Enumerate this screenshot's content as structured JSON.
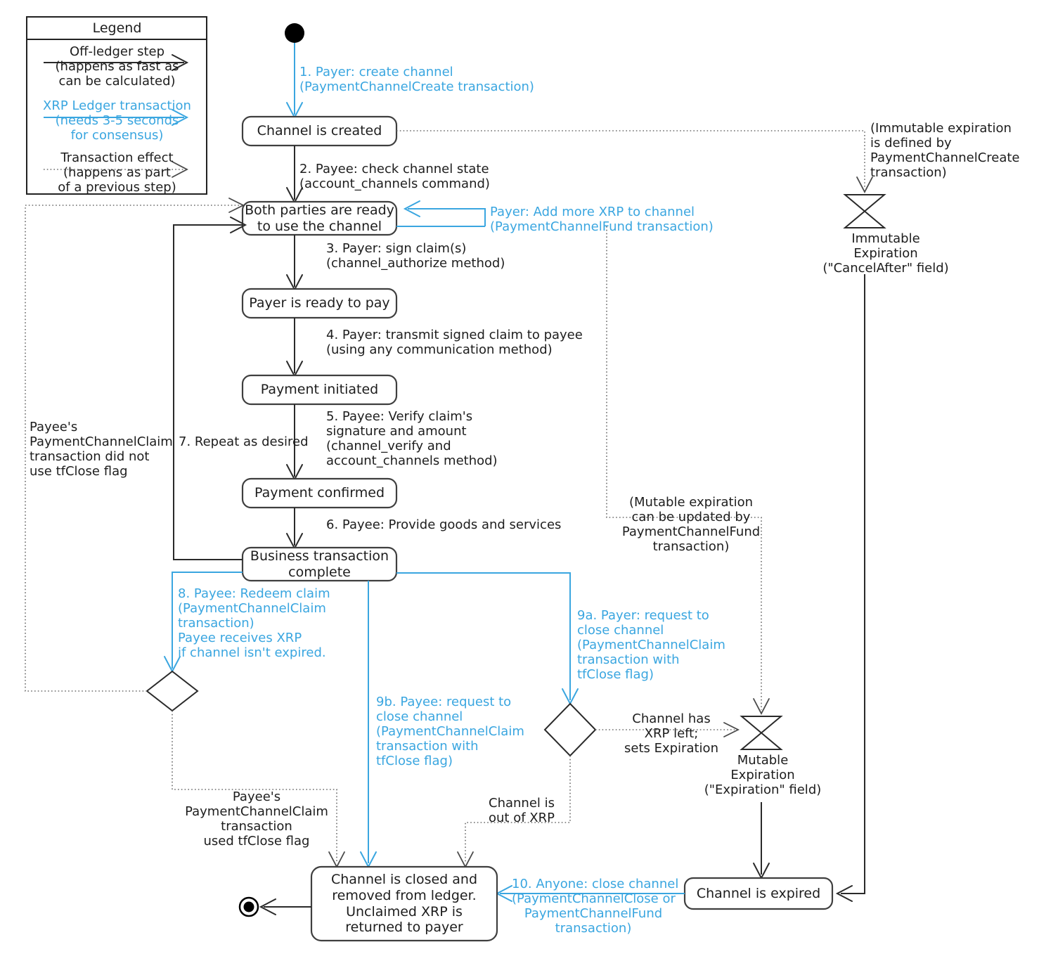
{
  "diagram": {
    "title": "XRP Ledger Payment Channel state diagram",
    "colors": {
      "ledger_blue": "#3aa6e0",
      "ink": "#1d1d1d",
      "dotted_gray": "#6b6b6b"
    }
  },
  "legend": {
    "title": "Legend",
    "entries": [
      {
        "name": "off-ledger-step",
        "line_style": "solid",
        "color": "#1d1d1d",
        "label": "Off-ledger step\n(happens as fast as\ncan be calculated)"
      },
      {
        "name": "xrp-ledger-transaction",
        "line_style": "solid",
        "color": "#3aa6e0",
        "label": "XRP Ledger transaction\n(needs 3-5 seconds\nfor consensus)"
      },
      {
        "name": "transaction-effect",
        "line_style": "dotted",
        "color": "#1d1d1d",
        "label": "Transaction effect\n(happens as part\nof a previous step)"
      }
    ]
  },
  "nodes": {
    "initial": "",
    "channel_created": "Channel is created",
    "both_ready": "Both parties are ready\nto use the channel",
    "payer_ready": "Payer is ready to pay",
    "payment_initiated": "Payment initiated",
    "payment_confirmed": "Payment confirmed",
    "business_complete": "Business transaction\ncomplete",
    "channel_closed": "Channel is closed and\nremoved from ledger.\nUnclaimed XRP is\nreturned to payer",
    "channel_expired": "Channel is expired",
    "immutable_expiration": "Immutable\nExpiration\n(\"CancelAfter\" field)",
    "mutable_expiration": "Mutable\nExpiration\n(\"Expiration\" field)",
    "final": ""
  },
  "edges": [
    {
      "id": "e1",
      "kind": "blue",
      "label": "1. Payer: create channel\n(PaymentChannelCreate transaction)"
    },
    {
      "id": "e2",
      "kind": "black",
      "label": "2. Payee: check channel state\n(account_channels command)"
    },
    {
      "id": "e3",
      "kind": "black",
      "label": "3. Payer: sign claim(s)\n(channel_authorize method)"
    },
    {
      "id": "e4",
      "kind": "black",
      "label": "4. Payer: transmit signed claim to payee\n(using any communication method)"
    },
    {
      "id": "e5",
      "kind": "black",
      "label": "5. Payee: Verify claim's\nsignature and amount\n(channel_verify and\naccount_channels method)"
    },
    {
      "id": "e6",
      "kind": "black",
      "label": "6. Payee: Provide goods and services"
    },
    {
      "id": "e7",
      "kind": "black",
      "label": "7. Repeat as desired"
    },
    {
      "id": "e8",
      "kind": "blue",
      "label": "8. Payee: Redeem claim\n(PaymentChannelClaim\ntransaction)\nPayee receives XRP\nif channel isn't expired."
    },
    {
      "id": "e9a",
      "kind": "blue",
      "label": "9a. Payer: request to\nclose channel\n(PaymentChannelClaim\ntransaction with\ntfClose flag)"
    },
    {
      "id": "e9b",
      "kind": "blue",
      "label": "9b. Payee: request to\nclose channel\n(PaymentChannelClaim\ntransaction with\ntfClose flag)"
    },
    {
      "id": "e10",
      "kind": "blue",
      "label": "10. Anyone: close channel\n(PaymentChannelClose or\nPaymentChannelFund\ntransaction)"
    },
    {
      "id": "efund",
      "kind": "blue",
      "label": "Payer: Add more XRP to channel\n(PaymentChannelFund transaction)"
    },
    {
      "id": "eimm",
      "kind": "dotted",
      "label": "(Immutable expiration\nis defined by\nPaymentChannelCreate\ntransaction)"
    },
    {
      "id": "emut",
      "kind": "dotted",
      "label": "(Mutable expiration\ncan be updated by\nPaymentChannelFund\ntransaction)"
    },
    {
      "id": "enoclose",
      "kind": "dotted",
      "label": "Payee's\nPaymentChannelClaim\ntransaction did not\nuse tfClose flag"
    },
    {
      "id": "eclose",
      "kind": "dotted",
      "label": "Payee's\nPaymentChannelClaim\ntransaction\nused tfClose flag"
    },
    {
      "id": "exrpleft",
      "kind": "dotted",
      "label": "Channel has\nXRP left;\nsets Expiration"
    },
    {
      "id": "eoutxrp",
      "kind": "dotted",
      "label": "Channel is\nout of XRP"
    }
  ]
}
